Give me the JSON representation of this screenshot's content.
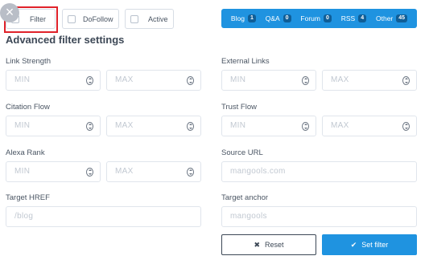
{
  "toolbar": {
    "filter_label": "Filter",
    "dofollow_label": "DoFollow",
    "active_label": "Active",
    "close_glyph": "×"
  },
  "tabs": [
    {
      "label": "Blog",
      "count": "1"
    },
    {
      "label": "Q&A",
      "count": "0"
    },
    {
      "label": "Forum",
      "count": "0"
    },
    {
      "label": "RSS",
      "count": "4"
    },
    {
      "label": "Other",
      "count": "45"
    }
  ],
  "title": "Advanced filter settings",
  "fields": {
    "link_strength": {
      "label": "Link Strength",
      "min": "MIN",
      "max": "MAX"
    },
    "external_links": {
      "label": "External Links",
      "min": "MIN",
      "max": "MAX"
    },
    "citation_flow": {
      "label": "Citation Flow",
      "min": "MIN",
      "max": "MAX"
    },
    "trust_flow": {
      "label": "Trust Flow",
      "min": "MIN",
      "max": "MAX"
    },
    "alexa_rank": {
      "label": "Alexa Rank",
      "min": "MIN",
      "max": "MAX"
    },
    "source_url": {
      "label": "Source URL",
      "placeholder": "mangools.com"
    },
    "target_href": {
      "label": "Target HREF",
      "placeholder": "/blog"
    },
    "target_anchor": {
      "label": "Target anchor",
      "placeholder": "mangools"
    }
  },
  "buttons": {
    "reset_label": "Reset",
    "reset_icon": "close-icon",
    "set_filter_label": "Set filter",
    "set_filter_icon": "check-icon"
  },
  "colors": {
    "accent": "#1f93e0",
    "highlight": "#e0222a"
  }
}
